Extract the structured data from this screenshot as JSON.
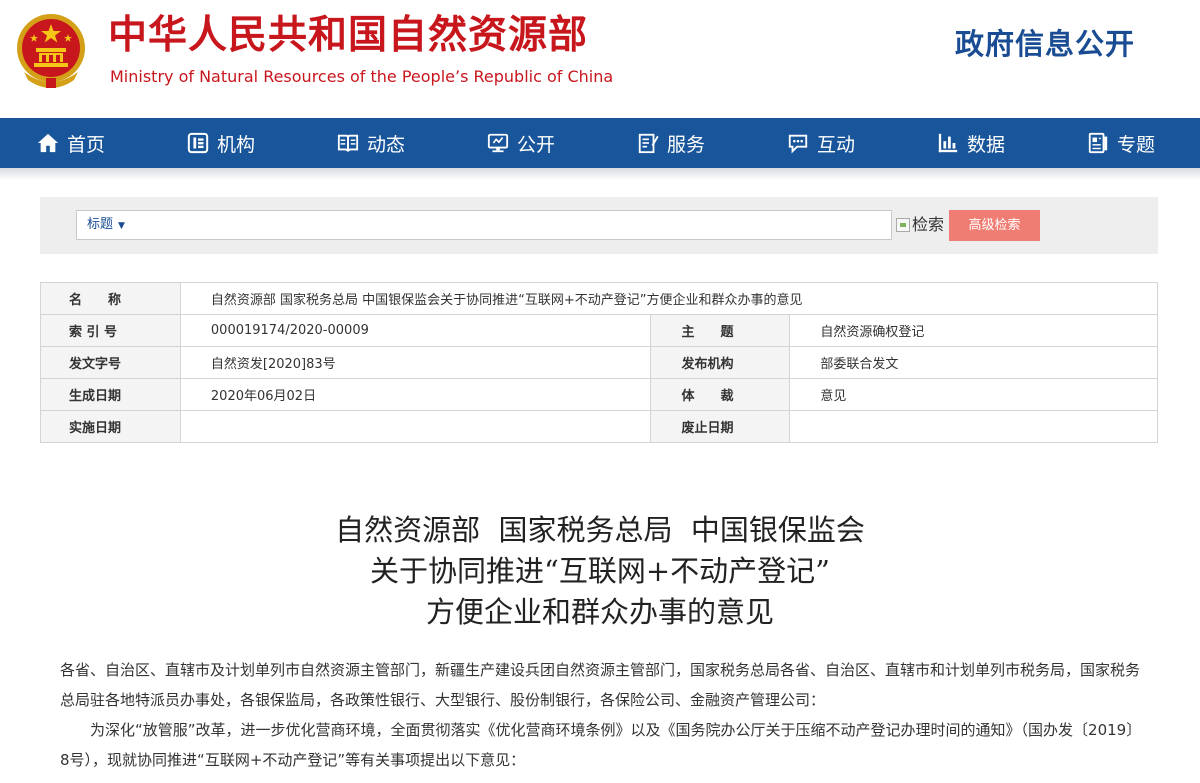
{
  "header": {
    "site_name_cn": "中华人民共和国自然资源部",
    "site_name_en": "Ministry of Natural Resources of the People’s Republic of China",
    "section_title": "政府信息公开",
    "colors": {
      "brand_red": "#c8161d",
      "nav_blue": "#18559a"
    }
  },
  "nav": {
    "items": [
      {
        "label": "首页",
        "icon": "home-icon"
      },
      {
        "label": "机构",
        "icon": "org-icon"
      },
      {
        "label": "动态",
        "icon": "book-icon"
      },
      {
        "label": "公开",
        "icon": "monitor-icon"
      },
      {
        "label": "服务",
        "icon": "edit-doc-icon"
      },
      {
        "label": "互动",
        "icon": "chat-icon"
      },
      {
        "label": "数据",
        "icon": "bar-chart-icon"
      },
      {
        "label": "专题",
        "icon": "topic-icon"
      }
    ]
  },
  "search": {
    "field_label": "标题",
    "input_value": "",
    "search_button_label": "检索",
    "advanced_button_label": "高级检索"
  },
  "info": {
    "name_label": "名　　称",
    "name_value": "自然资源部 国家税务总局 中国银保监会关于协同推进“互联网+不动产登记”方便企业和群众办事的意见",
    "index_label": "索 引 号",
    "index_value": "000019174/2020-00009",
    "subject_label": "主　　题",
    "subject_value": "自然资源确权登记",
    "doc_no_label": "发文字号",
    "doc_no_value": "自然资发[2020]83号",
    "issuer_label": "发布机构",
    "issuer_value": "部委联合发文",
    "created_label": "生成日期",
    "created_value": "2020年06月02日",
    "genre_label": "体　　裁",
    "genre_value": "意见",
    "effective_label": "实施日期",
    "effective_value": "",
    "abolished_label": "废止日期",
    "abolished_value": ""
  },
  "article": {
    "title_line1": "自然资源部  国家税务总局  中国银保监会",
    "title_line2": "关于协同推进“互联网+不动产登记”",
    "title_line3": "方便企业和群众办事的意见",
    "addressees": "各省、自治区、直辖市及计划单列市自然资源主管部门，新疆生产建设兵团自然资源主管部门，国家税务总局各省、自治区、直辖市和计划单列市税务局，国家税务总局驻各地特派员办事处，各银保监局，各政策性银行、大型银行、股份制银行，各保险公司、金融资产管理公司：",
    "paragraph1": "为深化“放管服”改革，进一步优化营商环境，全面贯彻落实《优化营商环境条例》以及《国务院办公厅关于压缩不动产登记办理时间的通知》（国办发〔2019〕8号），现就协同推进“互联网+不动产登记”等有关事项提出以下意见："
  }
}
